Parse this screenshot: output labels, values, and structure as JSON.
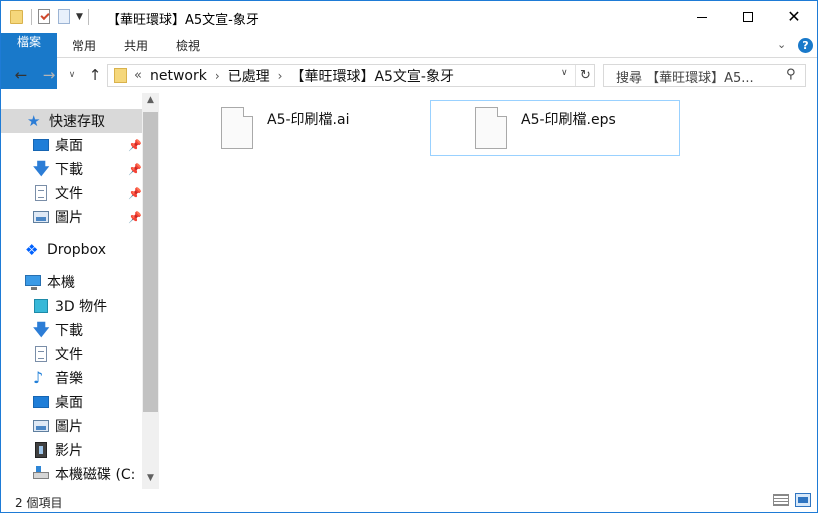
{
  "window": {
    "title": "【華旺環球】A5文宣-象牙",
    "minimize_label": "",
    "close_label": "✕"
  },
  "ribbon": {
    "tabs": [
      "檔案",
      "常用",
      "共用",
      "檢視"
    ],
    "expand_chevron": "⌄",
    "help": "?"
  },
  "address": {
    "overflow": "«",
    "crumbs": [
      "network",
      "已處理",
      "【華旺環球】A5文宣-象牙"
    ],
    "separator": "›"
  },
  "search": {
    "placeholder": "搜尋 【華旺環球】A5..."
  },
  "sidebar": {
    "quick_access": "快速存取",
    "pinned": [
      {
        "label": "桌面",
        "icon": "desktop-icon"
      },
      {
        "label": "下載",
        "icon": "download-icon"
      },
      {
        "label": "文件",
        "icon": "document-icon"
      },
      {
        "label": "圖片",
        "icon": "pictures-icon"
      }
    ],
    "dropbox": "Dropbox",
    "this_pc": "本機",
    "pc_items": [
      {
        "label": "3D 物件",
        "icon": "3d-objects-icon"
      },
      {
        "label": "下載",
        "icon": "download-icon"
      },
      {
        "label": "文件",
        "icon": "document-icon"
      },
      {
        "label": "音樂",
        "icon": "music-icon"
      },
      {
        "label": "桌面",
        "icon": "desktop-icon"
      },
      {
        "label": "圖片",
        "icon": "pictures-icon"
      },
      {
        "label": "影片",
        "icon": "videos-icon"
      },
      {
        "label": "本機磁碟 (C:",
        "icon": "drive-icon"
      }
    ]
  },
  "files": [
    {
      "name": "A5-印刷檔.ai",
      "selected": false
    },
    {
      "name": "A5-印刷檔.eps",
      "selected": true
    }
  ],
  "status": {
    "count": "2 個項目"
  },
  "colors": {
    "accent": "#1979ca",
    "selection_border": "#99d1ff",
    "window_border": "#1e7bd6"
  }
}
